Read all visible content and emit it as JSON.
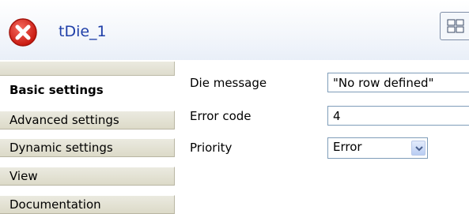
{
  "header": {
    "title": "tDie_1",
    "status_icon": "error-icon",
    "grid_icon": "grid-view-icon"
  },
  "sidebar": {
    "items": [
      {
        "label": "Basic settings",
        "active": true
      },
      {
        "label": "Advanced settings",
        "active": false
      },
      {
        "label": "Dynamic settings",
        "active": false
      },
      {
        "label": "View",
        "active": false
      },
      {
        "label": "Documentation",
        "active": false
      }
    ]
  },
  "form": {
    "die_message": {
      "label": "Die message",
      "value": "\"No row defined\""
    },
    "error_code": {
      "label": "Error code",
      "value": "4"
    },
    "priority": {
      "label": "Priority",
      "value": "Error"
    }
  },
  "colors": {
    "title": "#1f3fa8",
    "error_icon": "#d9261c",
    "sidebar_bg": "#e4e2d4",
    "input_border": "#7f9db9"
  }
}
